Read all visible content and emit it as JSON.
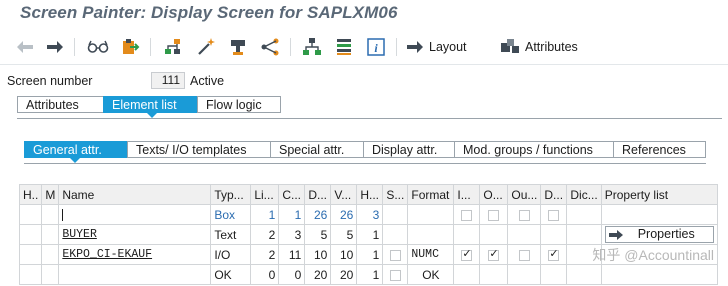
{
  "title": "Screen Painter: Display Screen for SAPLXM06",
  "toolbar": {
    "icons": [
      "back-arrow-icon",
      "forward-arrow-icon",
      "glasses-icon",
      "clipboard-transport-icon",
      "hierarchy-tree-icon",
      "magic-wand-icon",
      "stamp-icon",
      "branch-icon",
      "org-chart-icon",
      "stack-icon",
      "info-icon"
    ],
    "layout_label": "Layout",
    "attributes_label": "Attributes"
  },
  "screen": {
    "number_label": "Screen number",
    "number_value": "111",
    "status": "Active"
  },
  "main_tabs": [
    "Attributes",
    "Element list",
    "Flow logic"
  ],
  "main_tab_selected": 1,
  "sub_tabs": [
    "General attr.",
    "Texts/ I/O templates",
    "Special attr.",
    "Display attr.",
    "Mod. groups / functions",
    "References"
  ],
  "sub_tab_selected": 0,
  "grid": {
    "headers": [
      "H..",
      "M",
      "Name",
      "Typ...",
      "Li...",
      "C...",
      "D...",
      "V...",
      "H...",
      "S...",
      "Format",
      "I...",
      "O...",
      "Ou...",
      "D...",
      "Dic...",
      "Property list"
    ],
    "rows": [
      {
        "name": "",
        "type": "Box",
        "line": "1",
        "col": "1",
        "deflg": "26",
        "vislg": "26",
        "height": "3",
        "format": "",
        "property": ""
      },
      {
        "name": "BUYER",
        "type": "Text",
        "line": "2",
        "col": "3",
        "deflg": "5",
        "vislg": "5",
        "height": "1",
        "format": "",
        "property": "Properties"
      },
      {
        "name": "EKPO_CI-EKAUF",
        "type": "I/O",
        "line": "2",
        "col": "11",
        "deflg": "10",
        "vislg": "10",
        "height": "1",
        "format": "NUMC",
        "property": ""
      },
      {
        "name": "",
        "type": "OK",
        "line": "0",
        "col": "0",
        "deflg": "20",
        "vislg": "20",
        "height": "1",
        "format": "OK",
        "property": ""
      }
    ]
  },
  "watermark": "知乎 @Accountinall",
  "colors": {
    "accent": "#1a9bd7",
    "title": "#5a6877",
    "icon_green": "#2e9a48",
    "icon_orange": "#e38b1b"
  }
}
